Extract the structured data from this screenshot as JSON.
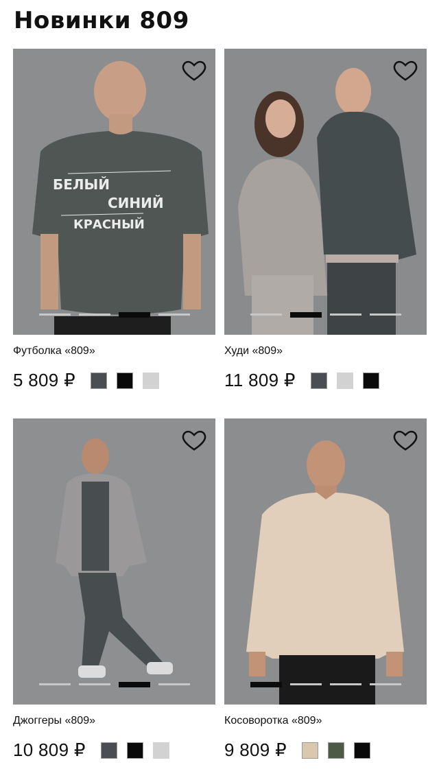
{
  "page": {
    "title": "Новинки 809"
  },
  "products": [
    {
      "name": "Футболка «809»",
      "price": "5 809 ₽",
      "swatches": [
        "#4a4e52",
        "#0a0a0a",
        "#d2d2d2"
      ],
      "print_lines": [
        "БЕЛЫЙ",
        "СИНИЙ",
        "КРАСНЫЙ"
      ],
      "carousel": {
        "count": 4,
        "active": 3
      }
    },
    {
      "name": "Худи «809»",
      "price": "11 809 ₽",
      "swatches": [
        "#4a4e52",
        "#d2d2d2",
        "#0a0a0a"
      ],
      "carousel": {
        "count": 4,
        "active": 2
      }
    },
    {
      "name": "Джоггеры «809»",
      "price": "10 809 ₽",
      "swatches": [
        "#4a4e52",
        "#0a0a0a",
        "#d2d2d2"
      ],
      "carousel": {
        "count": 4,
        "active": 3
      }
    },
    {
      "name": "Косоворотка «809»",
      "price": "9 809 ₽",
      "swatches": [
        "#d9c7ae",
        "#4d5a45",
        "#0a0a0a"
      ],
      "carousel": {
        "count": 4,
        "active": 1
      }
    }
  ],
  "icons": {
    "favorite": "heart-outline-icon"
  }
}
